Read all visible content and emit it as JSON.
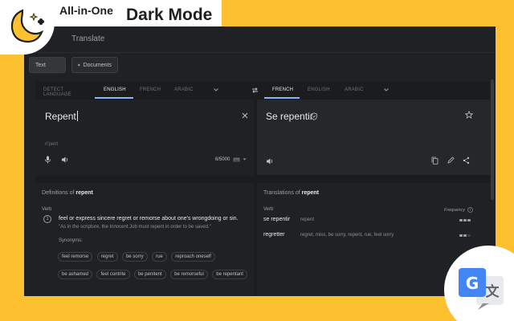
{
  "promo": {
    "title_small": "All-in-One",
    "title_big": "Dark Mode"
  },
  "app": {
    "title": "Translate"
  },
  "modes": [
    {
      "label": "Text"
    },
    {
      "label": "Documents"
    }
  ],
  "source_langs": [
    "DETECT LANGUAGE",
    "ENGLISH",
    "FRENCH",
    "ARABIC"
  ],
  "target_langs": [
    "FRENCH",
    "ENGLISH",
    "ARABIC"
  ],
  "source": {
    "text": "Repent",
    "phonetic": "ri'pent",
    "char_count": "6/5000"
  },
  "target": {
    "text": "Se repentir"
  },
  "definitions": {
    "heading_prefix": "Definitions of",
    "word": "repent",
    "pos": "Verb",
    "items": [
      {
        "num": "1",
        "text": "feel or express sincere regret or remorse about one's wrongdoing or sin.",
        "example": "\"As in the scripture, the Innocent Job must repent in order to be saved.\"",
        "synonyms_label": "Synonyms:",
        "synonyms": [
          "feel remorse",
          "regret",
          "be sorry",
          "rue",
          "reproach oneself",
          "be ashamed",
          "feel contrite",
          "be penitent",
          "be remorseful",
          "be repentant"
        ]
      }
    ]
  },
  "translations": {
    "heading_prefix": "Translations of",
    "word": "repent",
    "pos": "Verb",
    "frequency_label": "Frequency",
    "rows": [
      {
        "word": "se repentir",
        "synonyms": "repent",
        "frequency": 3
      },
      {
        "word": "regretter",
        "synonyms": "regret, miss, be sorry, repent, rue, feel sorry",
        "frequency": 2
      }
    ]
  },
  "colors": {
    "accent": "#8ab4f8",
    "background": "#fdc02f",
    "panel": "#202124"
  }
}
